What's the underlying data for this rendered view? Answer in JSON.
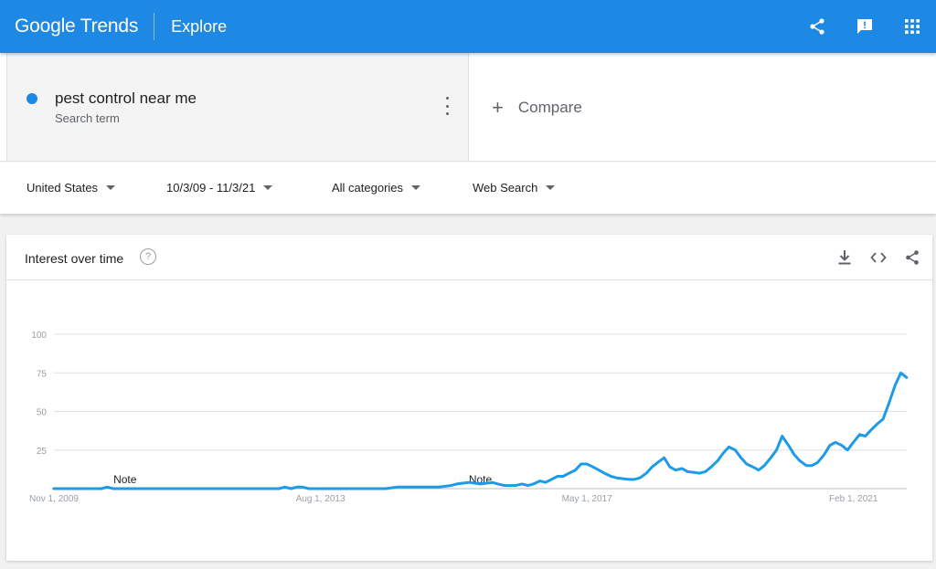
{
  "header": {
    "logo": "Google Trends",
    "page_title": "Explore",
    "icons": [
      "share-icon",
      "feedback-icon",
      "apps-icon"
    ]
  },
  "search": {
    "term": "pest control near me",
    "term_type": "Search term",
    "term_color": "#1e88e5",
    "compare_label": "Compare"
  },
  "filters": {
    "region": "United States",
    "date_range": "10/3/09 - 11/3/21",
    "category": "All categories",
    "search_type": "Web Search"
  },
  "card": {
    "title": "Interest over time",
    "help": "?",
    "actions": [
      "download-icon",
      "embed-icon",
      "share-icon"
    ]
  },
  "chart_data": {
    "type": "line",
    "xlabel": "",
    "ylabel": "",
    "ylim": [
      0,
      100
    ],
    "yticks": [
      25,
      50,
      75,
      100
    ],
    "xtick_labels": [
      "Nov 1, 2009",
      "Aug 1, 2013",
      "May 1, 2017",
      "Feb 1, 2021"
    ],
    "xtick_dates": [
      2009.833,
      2013.583,
      2017.333,
      2021.083
    ],
    "xlim": [
      2009.833,
      2021.833
    ],
    "grid": true,
    "color": "#1e9be8",
    "annotations": [
      {
        "text": "Note",
        "x": 2010.833
      },
      {
        "text": "Note",
        "x": 2015.833
      }
    ],
    "series": [
      {
        "name": "pest control near me",
        "x": [
          2009.83,
          2010.5,
          2010.58,
          2010.67,
          2011.5,
          2012.5,
          2013.0,
          2013.08,
          2013.17,
          2013.25,
          2013.33,
          2013.42,
          2013.5,
          2013.58,
          2014.0,
          2014.5,
          2014.67,
          2014.83,
          2015.0,
          2015.25,
          2015.42,
          2015.5,
          2015.67,
          2015.83,
          2016.0,
          2016.08,
          2016.17,
          2016.25,
          2016.33,
          2016.42,
          2016.5,
          2016.58,
          2016.67,
          2016.75,
          2016.92,
          2017.0,
          2017.08,
          2017.17,
          2017.25,
          2017.33,
          2017.42,
          2017.58,
          2017.67,
          2017.75,
          2017.92,
          2018.0,
          2018.08,
          2018.17,
          2018.25,
          2018.33,
          2018.42,
          2018.5,
          2018.58,
          2018.67,
          2018.75,
          2018.92,
          2019.0,
          2019.08,
          2019.17,
          2019.25,
          2019.33,
          2019.42,
          2019.5,
          2019.58,
          2019.67,
          2019.75,
          2019.83,
          2019.92,
          2020.0,
          2020.08,
          2020.17,
          2020.25,
          2020.33,
          2020.42,
          2020.5,
          2020.58,
          2020.67,
          2020.75,
          2020.83,
          2020.92,
          2021.0,
          2021.08,
          2021.17,
          2021.25,
          2021.33,
          2021.42,
          2021.5,
          2021.58,
          2021.67,
          2021.75,
          2021.83
        ],
        "values": [
          0,
          0,
          1,
          0,
          0,
          0,
          0,
          1,
          0,
          1,
          1,
          0,
          0,
          0,
          0,
          0,
          1,
          1,
          1,
          1,
          2,
          3,
          4,
          3,
          4,
          3,
          2,
          2,
          2,
          3,
          2,
          3,
          5,
          4,
          8,
          8,
          10,
          12,
          16,
          16,
          14,
          10,
          8,
          7,
          6,
          6,
          7,
          10,
          14,
          17,
          20,
          14,
          12,
          13,
          11,
          10,
          11,
          14,
          18,
          23,
          27,
          25,
          20,
          16,
          14,
          12,
          15,
          20,
          25,
          34,
          28,
          22,
          18,
          15,
          15,
          17,
          22,
          28,
          30,
          28,
          25,
          30,
          35,
          34,
          38,
          42,
          45,
          55,
          67,
          75,
          72
        ]
      }
    ]
  }
}
